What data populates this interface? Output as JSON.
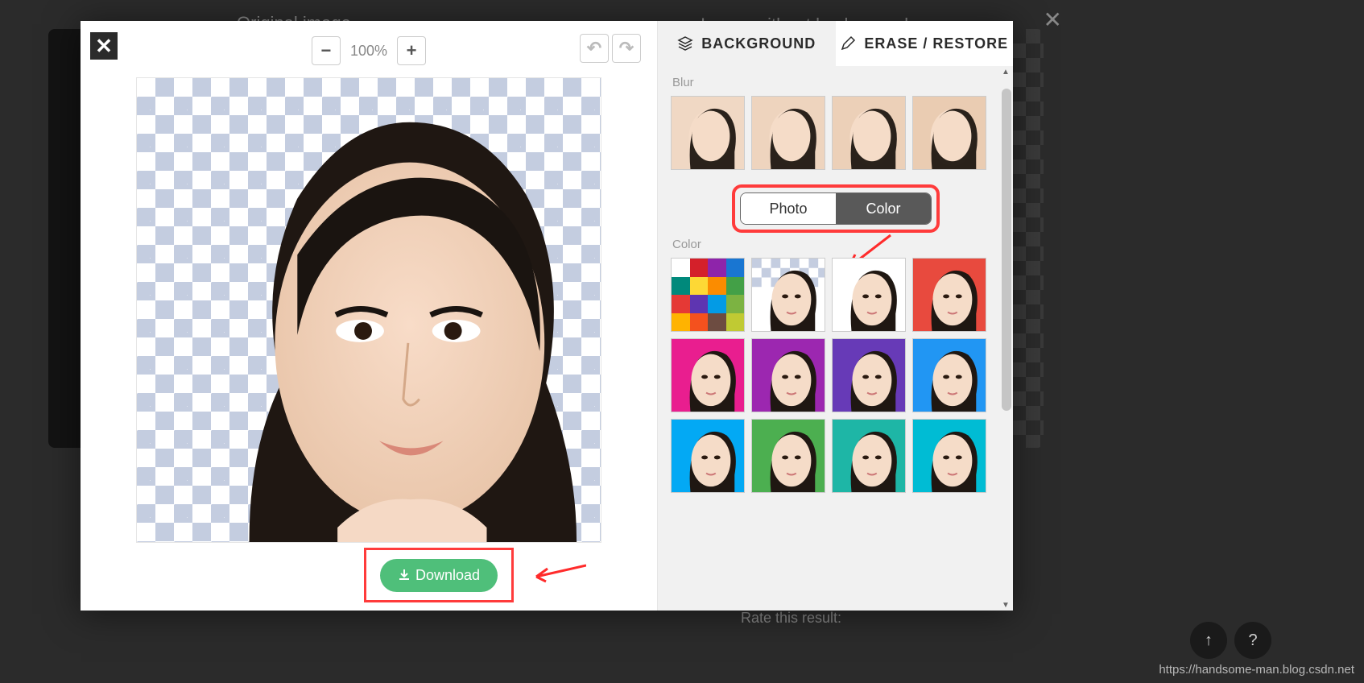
{
  "background_page": {
    "label_left": "Original image",
    "label_right": "Image without background",
    "rate_text": "Rate this result:"
  },
  "modal": {
    "toolbar": {
      "zoom_out_label": "−",
      "zoom_value": "100%",
      "zoom_in_label": "+",
      "undo_label": "↶",
      "redo_label": "↷"
    },
    "close_label": "✕",
    "download_label": "Download"
  },
  "tabs": {
    "background": "BACKGROUND",
    "erase_restore": "ERASE / RESTORE"
  },
  "sections": {
    "blur_label": "Blur",
    "color_label": "Color"
  },
  "toggle": {
    "photo": "Photo",
    "color": "Color"
  },
  "floating": {
    "up_label": "↑",
    "help_label": "?"
  },
  "watermark": "https://handsome-man.blog.csdn.net",
  "palette_colors": [
    "#ffffff",
    "#d4202a",
    "#8e24aa",
    "#1976d2",
    "#00897b",
    "#fdd835",
    "#fb8c00",
    "#43a047",
    "#e53935",
    "#5e35b1",
    "#039be5",
    "#7cb342",
    "#ffb300",
    "#f4511e",
    "#6d4c41",
    "#c0ca33"
  ],
  "color_thumbs": [
    {
      "bg": "checker"
    },
    {
      "bg": "#ffffff"
    },
    {
      "bg": "#e84a3e"
    },
    {
      "bg": "#e91e8f"
    },
    {
      "bg": "#9c27b0"
    },
    {
      "bg": "#673ab7"
    },
    {
      "bg": "#2196f3"
    },
    {
      "bg": "#03a9f4"
    },
    {
      "bg": "#4caf50"
    },
    {
      "bg": "#1eb6a6"
    },
    {
      "bg": "#00bcd4"
    }
  ]
}
